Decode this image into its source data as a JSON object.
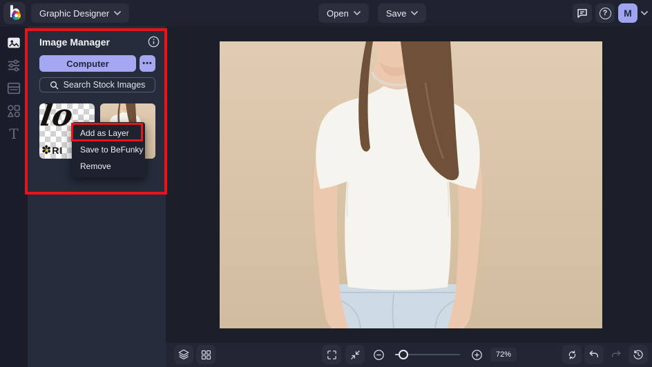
{
  "topbar": {
    "logo_letter": "b",
    "mode_label": "Graphic Designer",
    "open_label": "Open",
    "save_label": "Save",
    "help_glyph": "?",
    "avatar_initial": "M"
  },
  "sidebar": {
    "items": [
      {
        "name": "image-manager",
        "icon": "image-icon",
        "active": true
      },
      {
        "name": "customize",
        "icon": "sliders-icon",
        "active": false
      },
      {
        "name": "templates",
        "icon": "layout-icon",
        "active": false
      },
      {
        "name": "graphics",
        "icon": "shapes-icon",
        "active": false
      },
      {
        "name": "text",
        "icon": "text-icon",
        "active": false
      }
    ],
    "text_tool_glyph": "T"
  },
  "image_manager": {
    "title": "Image Manager",
    "computer_button_label": "Computer",
    "more_button_glyph": "•••",
    "search_placeholder": "Search Stock Images",
    "thumbnails": [
      {
        "name": "logo-image",
        "script_text": "lo",
        "flower_glyph": "✽",
        "caption_text": "RI"
      },
      {
        "name": "tshirt-model-image"
      }
    ],
    "context_menu": {
      "items": [
        "Add as Layer",
        "Save to BeFunky",
        "Remove"
      ]
    }
  },
  "canvas": {
    "zoom_badge": "72%"
  },
  "annotations": {
    "outer_box": "image-manager-panel-highlight",
    "inner_box": "add-as-layer-highlight"
  },
  "colors": {
    "accent_periwinkle": "#a3a8f0",
    "annotation_red": "#e8131b",
    "topbar_bg": "#1f2330",
    "panel_bg": "#272c3c",
    "canvas_bg": "#1c1f2a",
    "photo_beige": "#d9c3a8",
    "shirt_white": "#f6f4ef",
    "jeans_blue": "#cfdbe4"
  }
}
